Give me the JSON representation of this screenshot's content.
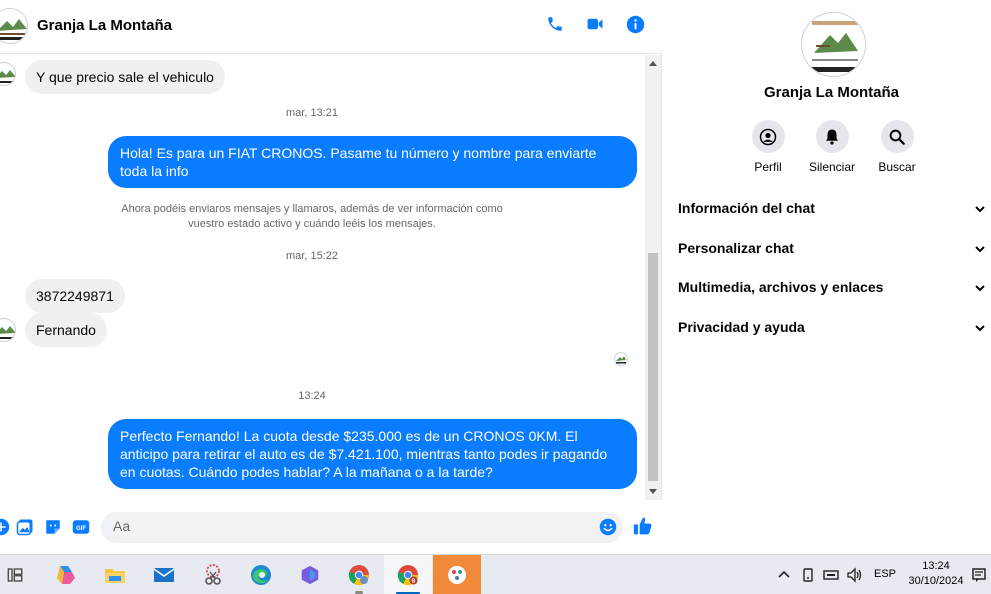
{
  "chat": {
    "title": "Granja La Montaña",
    "messages": {
      "m1": "Y que precio sale el vehiculo",
      "ts1": "mar, 13:21",
      "m2": "Hola! Es para un FIAT CRONOS. Pasame tu número y nombre para enviarte toda la info",
      "notice": "Ahora podéis enviaros mensajes y llamaros, además de ver información como vuestro estado activo y cuándo leéis los mensajes.",
      "ts2": "mar, 15:22",
      "m3": "3872249871",
      "m4": "Fernando",
      "ts3": "13:24",
      "m5": "Perfecto Fernando! La cuota desde $235.000 es de un CRONOS 0KM. El anticipo para retirar el auto es de $7.421.100, mientras tanto podes ir pagando en cuotas. Cuándo podes hablar? A la mañana o a la tarde?"
    },
    "composer": {
      "placeholder": "Aa"
    }
  },
  "info": {
    "name": "Granja La Montaña",
    "actions": {
      "profile": "Perfil",
      "mute": "Silenciar",
      "search": "Buscar"
    },
    "sections": {
      "chat_info": "Información del chat",
      "customize": "Personalizar chat",
      "media": "Multimedia, archivos y enlaces",
      "privacy": "Privacidad y ayuda"
    }
  },
  "taskbar": {
    "language": "ESP",
    "time": "13:24",
    "date": "30/10/2024"
  },
  "colors": {
    "accent": "#0a7cff",
    "bubble_in": "#f0f0f0",
    "muted_text": "#65676b"
  }
}
